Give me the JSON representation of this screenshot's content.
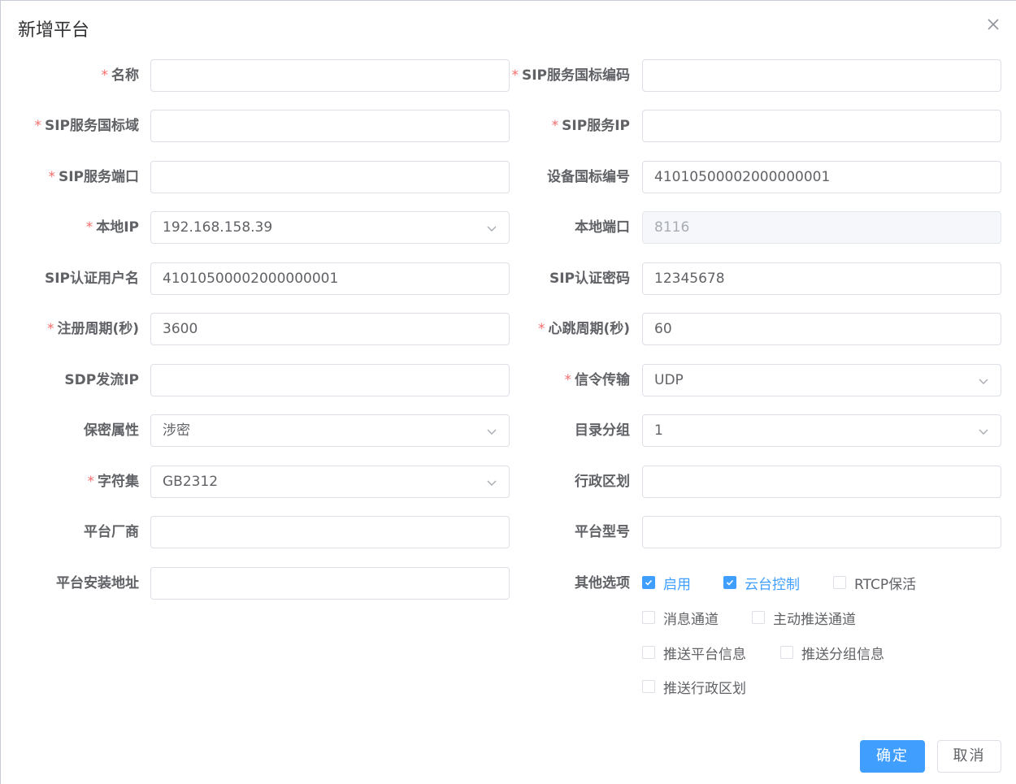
{
  "dialog": {
    "title": "新增平台",
    "close_icon": "close-icon"
  },
  "form": {
    "name": {
      "label": "名称",
      "required": true,
      "value": ""
    },
    "sip_id": {
      "label": "SIP服务国标编码",
      "required": true,
      "value": ""
    },
    "sip_domain": {
      "label": "SIP服务国标域",
      "required": true,
      "value": ""
    },
    "sip_ip": {
      "label": "SIP服务IP",
      "required": true,
      "value": ""
    },
    "sip_port": {
      "label": "SIP服务端口",
      "required": true,
      "value": ""
    },
    "device_gb_id": {
      "label": "设备国标编号",
      "required": false,
      "value": "41010500002000000001"
    },
    "local_ip": {
      "label": "本地IP",
      "required": true,
      "value": "192.168.158.39"
    },
    "local_port": {
      "label": "本地端口",
      "required": false,
      "value": "8116"
    },
    "auth_username": {
      "label": "SIP认证用户名",
      "required": false,
      "value": "41010500002000000001"
    },
    "auth_password": {
      "label": "SIP认证密码",
      "required": false,
      "value": "12345678"
    },
    "register_period": {
      "label": "注册周期(秒)",
      "required": true,
      "value": "3600"
    },
    "heartbeat_period": {
      "label": "心跳周期(秒)",
      "required": true,
      "value": "60"
    },
    "sdp_ip": {
      "label": "SDP发流IP",
      "required": false,
      "value": ""
    },
    "transport": {
      "label": "信令传输",
      "required": true,
      "value": "UDP"
    },
    "secrecy": {
      "label": "保密属性",
      "required": false,
      "value": "涉密"
    },
    "catalog_group": {
      "label": "目录分组",
      "required": false,
      "value": "1"
    },
    "charset": {
      "label": "字符集",
      "required": true,
      "value": "GB2312"
    },
    "civil_code": {
      "label": "行政区划",
      "required": false,
      "value": ""
    },
    "manufacturer": {
      "label": "平台厂商",
      "required": false,
      "value": ""
    },
    "model": {
      "label": "平台型号",
      "required": false,
      "value": ""
    },
    "address": {
      "label": "平台安装地址",
      "required": false,
      "value": ""
    },
    "options": {
      "label": "其他选项",
      "items": [
        {
          "label": "启用",
          "checked": true
        },
        {
          "label": "云台控制",
          "checked": true
        },
        {
          "label": "RTCP保活",
          "checked": false
        },
        {
          "label": "消息通道",
          "checked": false
        },
        {
          "label": "主动推送通道",
          "checked": false
        },
        {
          "label": "推送平台信息",
          "checked": false
        },
        {
          "label": "推送分组信息",
          "checked": false
        },
        {
          "label": "推送行政区划",
          "checked": false
        }
      ]
    },
    "required_mark": "*"
  },
  "buttons": {
    "confirm": "确定",
    "cancel": "取消"
  },
  "colors": {
    "primary": "#409eff",
    "required": "#f56c6c"
  }
}
